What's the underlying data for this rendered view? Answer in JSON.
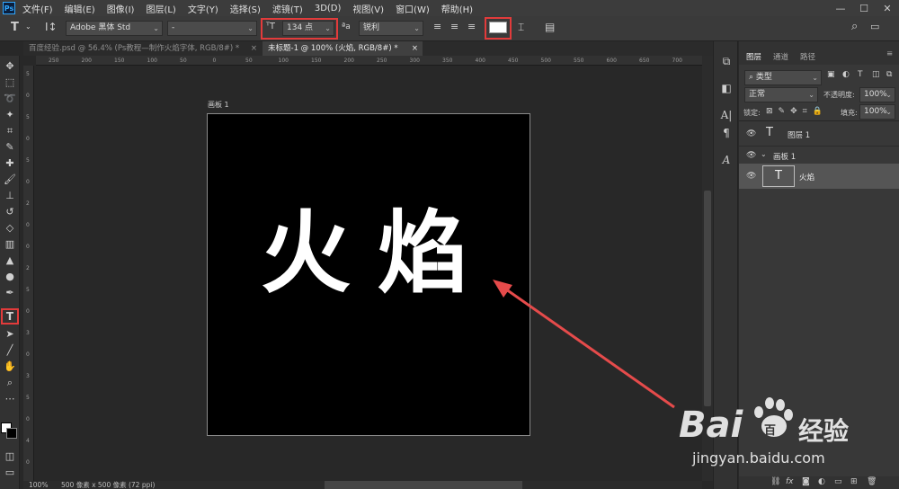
{
  "app": {
    "logo": "Ps"
  },
  "menu": [
    "文件(F)",
    "编辑(E)",
    "图像(I)",
    "图层(L)",
    "文字(Y)",
    "选择(S)",
    "滤镜(T)",
    "3D(D)",
    "视图(V)",
    "窗口(W)",
    "帮助(H)"
  ],
  "window_controls": {
    "minimize": "—",
    "maximize": "☐",
    "close": "✕"
  },
  "options": {
    "tool_icon": "T",
    "font_family": "Adobe 黑体 Std",
    "font_style": "-",
    "font_size": "134 点",
    "anti_alias_icon": "ªa",
    "anti_alias": "锐利",
    "accent_color": "#e23b3b",
    "text_color": "#ffffff"
  },
  "tabs": [
    {
      "label": "百度经验.psd @ 56.4% (Ps教程—制作火焰字体, RGB/8#) *",
      "active": false
    },
    {
      "label": "未标题-1 @ 100% (火焰, RGB/8#) *",
      "active": true
    }
  ],
  "tab_close": "×",
  "ruler_top": [
    "250",
    "200",
    "150",
    "100",
    "50",
    "0",
    "50",
    "100",
    "150",
    "200",
    "250",
    "300",
    "350",
    "400",
    "450",
    "500",
    "550",
    "600",
    "650",
    "700"
  ],
  "ruler_left": [
    "5",
    "0",
    "5",
    "0",
    "5",
    "0",
    "2",
    "0",
    "0",
    "2",
    "5",
    "0",
    "3",
    "0",
    "3",
    "5",
    "0",
    "4",
    "0"
  ],
  "canvas": {
    "artboard_label": "画板 1",
    "text": "火焰",
    "background": "#000000"
  },
  "status": {
    "zoom": "100%",
    "doc_size": "500 像素 x 500 像素 (72 ppi)"
  },
  "layers_panel": {
    "tabs": [
      "图层",
      "通道",
      "路径"
    ],
    "filter": "类型",
    "blend_mode": "正常",
    "opacity_label": "不透明度:",
    "opacity": "100%",
    "lock_label": "锁定:",
    "fill_label": "填充:",
    "fill": "100%",
    "layers": [
      {
        "name": "图层 1",
        "kind": "text"
      },
      {
        "name": "画板 1",
        "kind": "artboard"
      },
      {
        "name": "火焰",
        "kind": "text",
        "selected": true
      }
    ],
    "footer_icons": [
      "link-icon",
      "fx-icon",
      "mask-icon",
      "adjustment-icon",
      "folder-icon",
      "new-layer-icon",
      "trash-icon"
    ]
  },
  "watermark": {
    "brand_left": "Bai",
    "brand_right": "百",
    "brand_cn": "经验",
    "url": "jingyan.baidu.com"
  }
}
